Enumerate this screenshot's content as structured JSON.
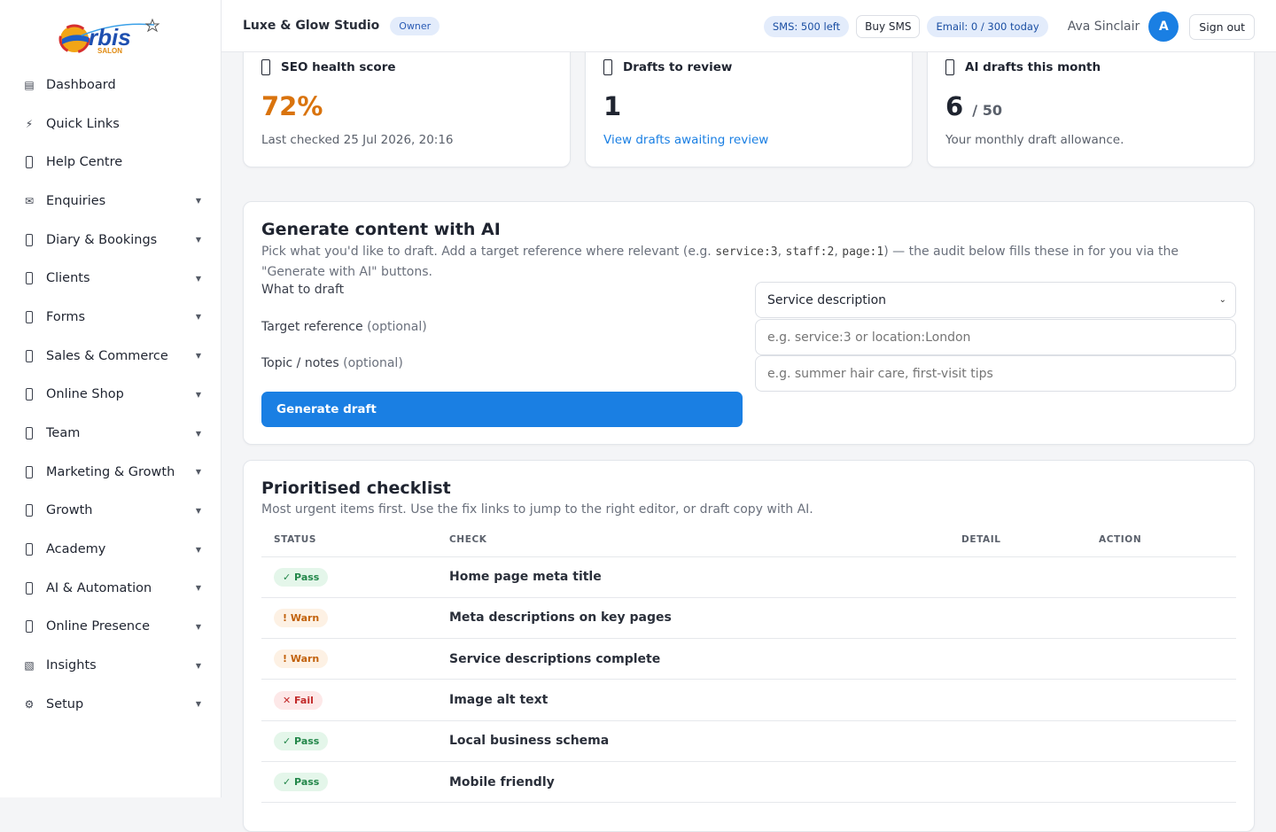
{
  "brand": {
    "logo_text": "rbis",
    "logo_initial": "O",
    "logo_sub": "SALON"
  },
  "sidebar": {
    "items": [
      {
        "label": "Dashboard",
        "icon": "dashboard-icon",
        "glyph": "▤",
        "caret": false
      },
      {
        "label": "Quick Links",
        "icon": "lightning-icon",
        "glyph": "⚡",
        "caret": false
      },
      {
        "label": "Help Centre",
        "icon": "help-icon",
        "glyph": "",
        "caret": false
      },
      {
        "label": "Enquiries",
        "icon": "envelope-icon",
        "glyph": "✉",
        "caret": true
      },
      {
        "label": "Diary & Bookings",
        "icon": "calendar-icon",
        "glyph": "",
        "caret": true
      },
      {
        "label": "Clients",
        "icon": "clients-icon",
        "glyph": "",
        "caret": true
      },
      {
        "label": "Forms",
        "icon": "forms-icon",
        "glyph": "",
        "caret": true
      },
      {
        "label": "Sales & Commerce",
        "icon": "sales-icon",
        "glyph": "",
        "caret": true
      },
      {
        "label": "Online Shop",
        "icon": "shop-icon",
        "glyph": "",
        "caret": true
      },
      {
        "label": "Team",
        "icon": "team-icon",
        "glyph": "",
        "caret": true
      },
      {
        "label": "Marketing & Growth",
        "icon": "marketing-icon",
        "glyph": "",
        "caret": true
      },
      {
        "label": "Growth",
        "icon": "growth-icon",
        "glyph": "",
        "caret": true
      },
      {
        "label": "Academy",
        "icon": "academy-icon",
        "glyph": "",
        "caret": true
      },
      {
        "label": "AI & Automation",
        "icon": "ai-icon",
        "glyph": "",
        "caret": true
      },
      {
        "label": "Online Presence",
        "icon": "globe-icon",
        "glyph": "",
        "caret": true
      },
      {
        "label": "Insights",
        "icon": "chart-icon",
        "glyph": "▧",
        "caret": true
      },
      {
        "label": "Setup",
        "icon": "gear-icon",
        "glyph": "⚙",
        "caret": true
      }
    ]
  },
  "topbar": {
    "studio": "Luxe & Glow Studio",
    "role": "Owner",
    "sms": "SMS: 500 left",
    "buy_sms": "Buy SMS",
    "email": "Email: 0 / 300 today",
    "user": "Ava Sinclair",
    "avatar_initial": "A",
    "sign_out": "Sign out"
  },
  "stats": {
    "seo": {
      "title": "SEO health score",
      "value": "72%",
      "sub": "Last checked 25 Jul 2026, 20:16",
      "value_color": "#d9730d"
    },
    "drafts": {
      "title": "Drafts to review",
      "value": "1",
      "link": "View drafts awaiting review"
    },
    "ai": {
      "title": "AI drafts this month",
      "value": "6",
      "limit": "/ 50",
      "sub": "Your monthly draft allowance."
    }
  },
  "generate": {
    "title": "Generate content with AI",
    "desc_pre": "Pick what you'd like to draft. Add a target reference where relevant (e.g. ",
    "code1": "service:3",
    "sep1": ", ",
    "code2": "staff:2",
    "sep2": ", ",
    "code3": "page:1",
    "desc_post": ") — the audit below fills these in for you via the \"Generate with AI\" buttons.",
    "what_label": "What to draft",
    "target_label": "Target reference",
    "target_opt": "(optional)",
    "topic_label": "Topic / notes",
    "topic_opt": "(optional)",
    "select_value": "Service description",
    "target_placeholder": "e.g. service:3 or location:London",
    "topic_placeholder": "e.g. summer hair care, first-visit tips",
    "button": "Generate draft"
  },
  "checklist": {
    "title": "Prioritised checklist",
    "desc": "Most urgent items first. Use the fix links to jump to the right editor, or draft copy with AI.",
    "headers": [
      "STATUS",
      "CHECK",
      "DETAIL",
      "ACTION"
    ],
    "rows": [
      {
        "status": "✓ Pass",
        "kind": "pass",
        "check": "Home page meta title"
      },
      {
        "status": "! Warn",
        "kind": "warn",
        "check": "Meta descriptions on key pages"
      },
      {
        "status": "! Warn",
        "kind": "warn",
        "check": "Service descriptions complete"
      },
      {
        "status": "✕ Fail",
        "kind": "fail",
        "check": "Image alt text"
      },
      {
        "status": "✓ Pass",
        "kind": "pass",
        "check": "Local business schema"
      },
      {
        "status": "✓ Pass",
        "kind": "pass",
        "check": "Mobile friendly"
      }
    ]
  }
}
